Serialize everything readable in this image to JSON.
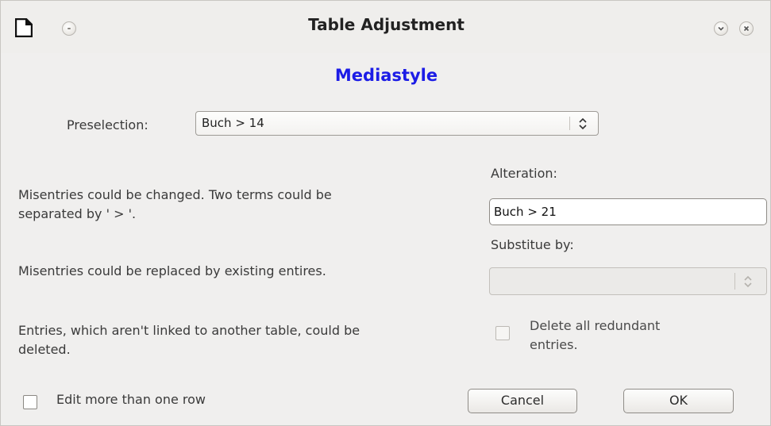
{
  "window": {
    "title": "Table Adjustment"
  },
  "dialog": {
    "heading": "Mediastyle",
    "preselection": {
      "label": "Preselection:",
      "value": "Buch > 14"
    },
    "alteration": {
      "label": "Alteration:",
      "value": "Buch > 21",
      "description_line1": "Misentries could be changed. Two terms could be",
      "description_line2": "separated by ' > '."
    },
    "substitute": {
      "label": "Substitue by:",
      "value": "",
      "description": "Misentries could be replaced by existing entires."
    },
    "delete": {
      "description_line1": "Entries, which aren't linked to another table, could be",
      "description_line2": "deleted.",
      "checkbox_line1": "Delete all redundant",
      "checkbox_line2": "entries."
    },
    "edit_multiple": {
      "label": "Edit more than one row"
    },
    "buttons": {
      "cancel": "Cancel",
      "ok": "OK"
    }
  },
  "icons": {
    "app": "document-icon",
    "window_menu": "window-menu-icon",
    "minimize": "chevron-down-icon",
    "close": "close-icon",
    "combo_arrows": "up-down-arrows-icon"
  },
  "colors": {
    "heading": "#1c1ce6",
    "background": "#f0efee"
  }
}
